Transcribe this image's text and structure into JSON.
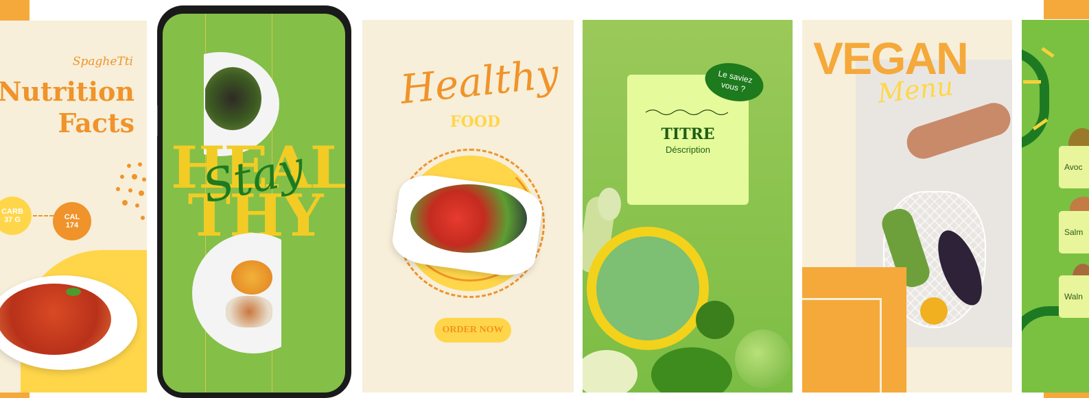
{
  "colors": {
    "orange": "#f0932a",
    "yellow": "#ffd64a",
    "green": "#84bf48",
    "cream": "#f7efd9",
    "dark_green": "#1f7a1f"
  },
  "card1": {
    "subtitle": "SpagheTti",
    "title_line1": "Nutrition",
    "title_line2": "Facts",
    "carb_label": "CARB",
    "carb_value": "37 G",
    "cal_label": "CAL",
    "cal_value": "174"
  },
  "card2": {
    "big_word_top": "HEAL",
    "big_word_bottom": "THY",
    "script_word": "Stay"
  },
  "card3": {
    "script_word": "Healthy",
    "sub_word": "FOOD",
    "button": "ORDER NOW"
  },
  "card4": {
    "badge_line1": "Le saviez",
    "badge_line2": "vous ?",
    "title": "TITRE",
    "description": "Déscription"
  },
  "card5": {
    "title": "VEGAN",
    "script_word": "Menu"
  },
  "card6": {
    "items": [
      "Avoc",
      "Salm",
      "Waln"
    ]
  }
}
